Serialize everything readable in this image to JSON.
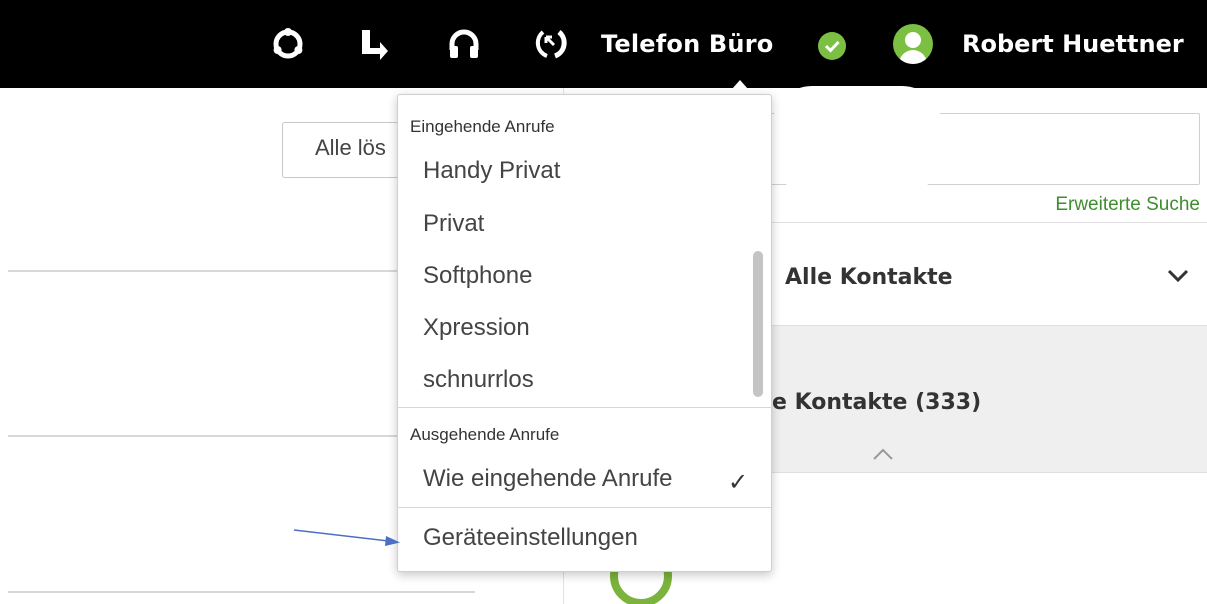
{
  "topbar": {
    "icons": [
      "presence-icon",
      "call-forward-icon",
      "headset-icon",
      "phone-callback-icon"
    ],
    "device_name": "Telefon Büro",
    "status_color": "#7bc043",
    "user_name": "Robert Huettner"
  },
  "left_panel": {
    "clear_all_button": "Alle lös"
  },
  "right_panel": {
    "search_value": "",
    "advanced_search_link": "Erweiterte Suche",
    "contacts_filter": "Alle Kontakte",
    "contacts_group_title": "e Kontakte (333)",
    "accent_color": "#3e8e2c"
  },
  "device_menu": {
    "incoming_header": "Eingehende Anrufe",
    "incoming_items": [
      "Handy Privat",
      "Privat",
      "Softphone",
      "Xpression",
      "schnurrlos"
    ],
    "outgoing_header": "Ausgehende Anrufe",
    "outgoing_item": "Wie eingehende Anrufe",
    "outgoing_checkmark": "✓",
    "settings_item": "Geräteeinstellungen"
  }
}
